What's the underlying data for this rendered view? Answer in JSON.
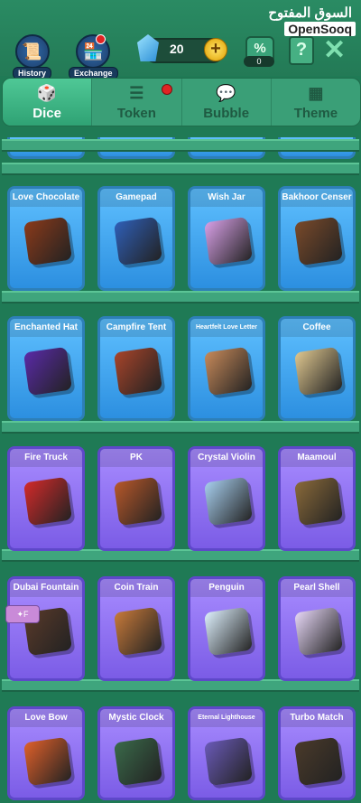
{
  "topbar": {
    "history_label": "History",
    "exchange_label": "Exchange",
    "gem_count": "20",
    "discount_count": "0",
    "watermark_ar": "السوق المفتوح",
    "watermark_en": "OpenSooq"
  },
  "tabs": [
    {
      "label": "Dice",
      "active": true
    },
    {
      "label": "Token",
      "active": false,
      "notification": true
    },
    {
      "label": "Bubble",
      "active": false
    },
    {
      "label": "Theme",
      "active": false
    }
  ],
  "items": [
    {
      "name": "Love Chocolate",
      "color": "#8b3a1a"
    },
    {
      "name": "Gamepad",
      "color": "#2f5fb8"
    },
    {
      "name": "Wish Jar",
      "color": "#d9a0e8"
    },
    {
      "name": "Bakhoor Censer",
      "color": "#7a4a2a"
    },
    {
      "name": "Enchanted Hat",
      "color": "#5a2aa8"
    },
    {
      "name": "Campfire Tent",
      "color": "#a8442a"
    },
    {
      "name": "Heartfelt Love Letter",
      "color": "#c88a5a"
    },
    {
      "name": "Coffee",
      "color": "#e0c890"
    },
    {
      "name": "Fire Truck",
      "color": "#d42a2a"
    },
    {
      "name": "PK",
      "color": "#b8582a"
    },
    {
      "name": "Crystal Violin",
      "color": "#a8d0f0"
    },
    {
      "name": "Maamoul",
      "color": "#8a6a3a"
    },
    {
      "name": "Dubai Fountain",
      "color": "#5a3a2a"
    },
    {
      "name": "Coin Train",
      "color": "#c87a3a"
    },
    {
      "name": "Penguin",
      "color": "#dff2ff"
    },
    {
      "name": "Pearl Shell",
      "color": "#e8d8f8"
    },
    {
      "name": "Love Bow",
      "color": "#e0602a"
    },
    {
      "name": "Mystic Clock",
      "color": "#3a6a4a"
    },
    {
      "name": "Eternal Lighthouse",
      "color": "#6a5ab8"
    },
    {
      "name": "Turbo Match",
      "color": "#4a3a2a"
    }
  ]
}
